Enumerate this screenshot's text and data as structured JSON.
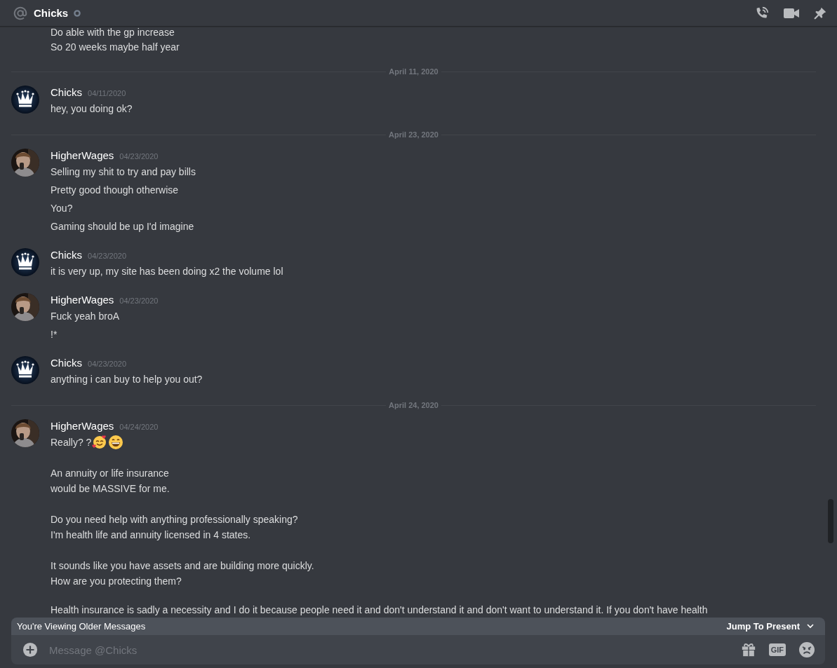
{
  "header": {
    "title": "Chicks"
  },
  "feed": [
    {
      "kind": "continuation",
      "text": "Do able with the gp increase"
    },
    {
      "kind": "continuation",
      "text": "So 20 weeks maybe half year"
    },
    {
      "kind": "divider",
      "label": "April 11, 2020"
    },
    {
      "kind": "message",
      "author": "Chicks",
      "avatar": {
        "kind": "crown"
      },
      "timestamp": "04/11/2020",
      "entries": [
        {
          "paragraphs": [
            [
              "hey, you doing ok?"
            ]
          ]
        }
      ]
    },
    {
      "kind": "divider",
      "label": "April 23, 2020"
    },
    {
      "kind": "message",
      "author": "HigherWages",
      "avatar": {
        "kind": "picture"
      },
      "timestamp": "04/23/2020",
      "entries": [
        {
          "paragraphs": [
            [
              "Selling my shit to try and pay bills"
            ]
          ]
        },
        {
          "paragraphs": [
            [
              "Pretty good though otherwise"
            ]
          ]
        },
        {
          "paragraphs": [
            [
              "You?"
            ]
          ]
        },
        {
          "paragraphs": [
            [
              "Gaming should be up I'd imagine"
            ]
          ]
        }
      ]
    },
    {
      "kind": "message",
      "author": "Chicks",
      "avatar": {
        "kind": "crown"
      },
      "timestamp": "04/23/2020",
      "entries": [
        {
          "paragraphs": [
            [
              "it is very up, my site has been doing x2 the volume lol"
            ]
          ]
        }
      ]
    },
    {
      "kind": "message",
      "author": "HigherWages",
      "avatar": {
        "kind": "picture"
      },
      "timestamp": "04/23/2020",
      "entries": [
        {
          "paragraphs": [
            [
              "Fuck yeah broA"
            ]
          ]
        },
        {
          "paragraphs": [
            [
              "!*"
            ]
          ]
        }
      ]
    },
    {
      "kind": "message",
      "author": "Chicks",
      "avatar": {
        "kind": "crown"
      },
      "timestamp": "04/23/2020",
      "entries": [
        {
          "paragraphs": [
            [
              "anything i can buy to help you out?"
            ]
          ]
        }
      ]
    },
    {
      "kind": "divider",
      "label": "April 24, 2020"
    },
    {
      "kind": "message",
      "author": "HigherWages",
      "avatar": {
        "kind": "picture"
      },
      "timestamp": "04/24/2020",
      "entries": [
        {
          "paragraphs": [
            [
              "Really? ?"
            ],
            [
              "An annuity or life insurance",
              "would be MASSIVE for me."
            ],
            [
              "Do you need help with anything professionally speaking?",
              "I'm health life and annuity licensed in 4 states."
            ],
            [
              "It sounds like you have assets and are building more quickly.",
              "How are you protecting them?"
            ],
            [
              "Health insurance is sadly a necessity and I do it because people need it and don't understand it and don't want to understand it. If you don't have health"
            ]
          ],
          "emoji": [
            {
              "kind": "hearts"
            },
            {
              "kind": "grin"
            }
          ]
        }
      ]
    }
  ],
  "banner": {
    "text": "You're Viewing Older Messages",
    "action": "Jump To Present"
  },
  "composer": {
    "placeholder": "Message @Chicks",
    "gif_label": "GIF"
  }
}
